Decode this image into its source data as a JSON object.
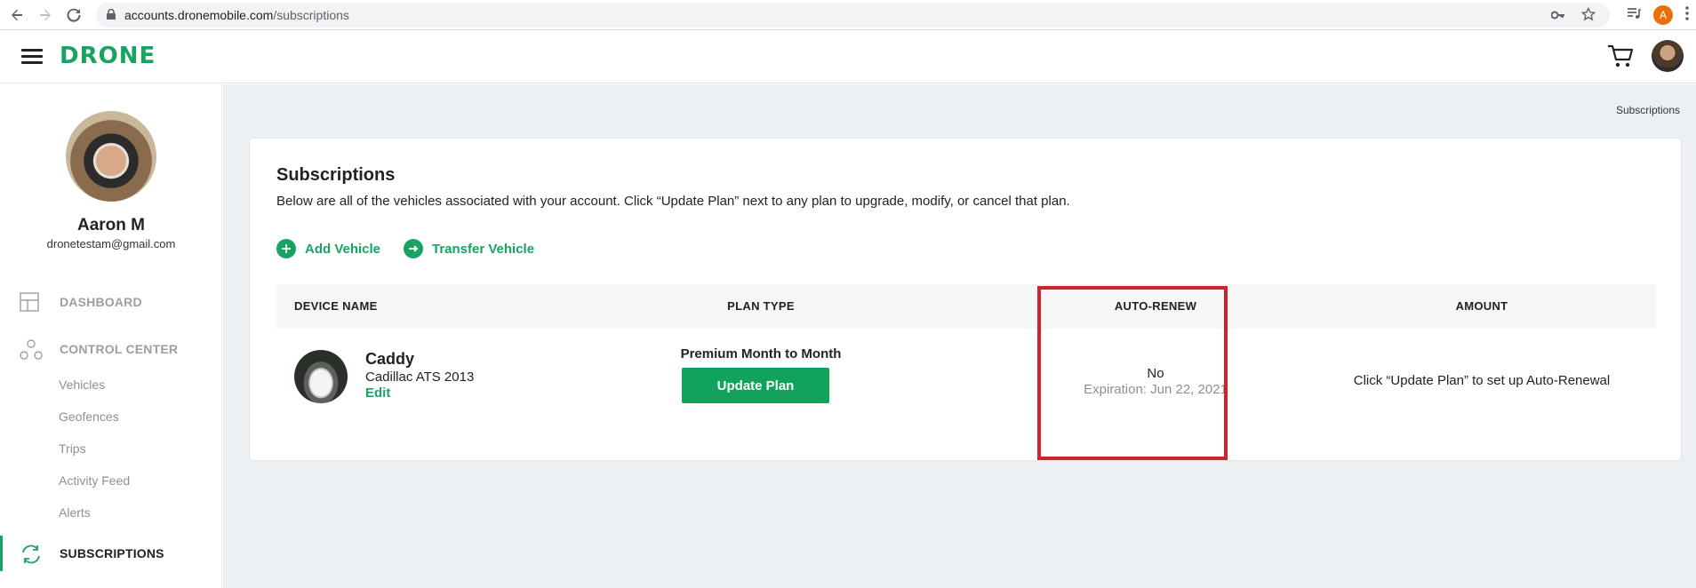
{
  "browser": {
    "url_host": "accounts.dronemobile.com",
    "url_path": "/subscriptions",
    "profile_initial": "A"
  },
  "header": {
    "logo": "DRONE"
  },
  "profile": {
    "name": "Aaron M",
    "email": "dronetestam@gmail.com"
  },
  "nav": {
    "dashboard": "DASHBOARD",
    "control_center": "CONTROL CENTER",
    "sub_items": [
      "Vehicles",
      "Geofences",
      "Trips",
      "Activity Feed",
      "Alerts"
    ],
    "subscriptions": "SUBSCRIPTIONS"
  },
  "breadcrumb": "Subscriptions",
  "card": {
    "title": "Subscriptions",
    "description": "Below are all of the vehicles associated with your account. Click “Update Plan” next to any plan to upgrade, modify, or cancel that plan.",
    "add_vehicle": "Add Vehicle",
    "transfer_vehicle": "Transfer Vehicle"
  },
  "table": {
    "headers": [
      "DEVICE NAME",
      "PLAN TYPE",
      "AUTO-RENEW",
      "AMOUNT"
    ],
    "row": {
      "device_name": "Caddy",
      "device_model": "Cadillac ATS 2013",
      "edit": "Edit",
      "plan": "Premium Month to Month",
      "update_plan": "Update Plan",
      "auto_renew": "No",
      "expiration": "Expiration: Jun 22, 2021",
      "amount": "Click “Update Plan” to set up Auto-Renewal"
    }
  },
  "colors": {
    "brand_green": "#1aa263",
    "button_green": "#0fa35b",
    "highlight_red": "#d1232a"
  }
}
